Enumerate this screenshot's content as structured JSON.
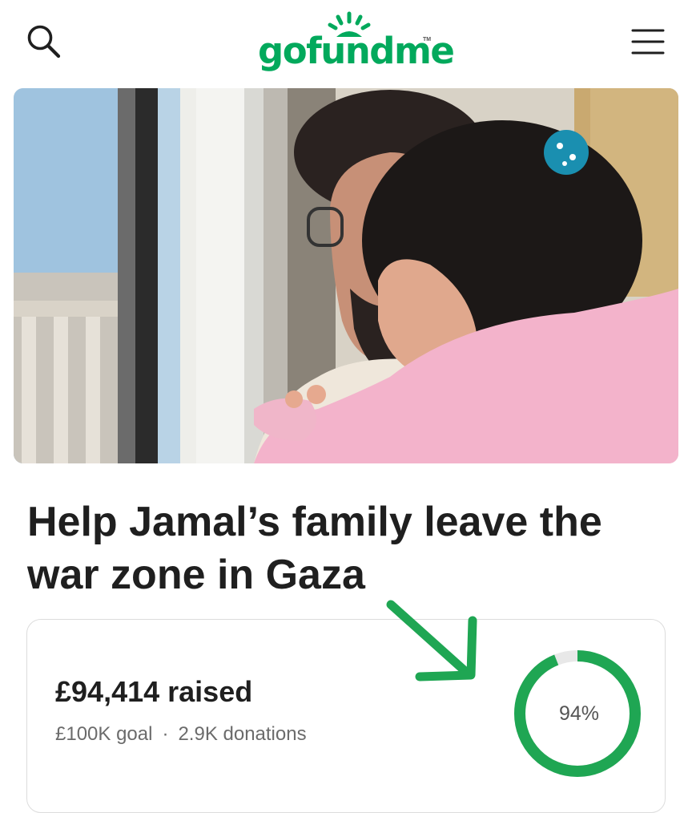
{
  "header": {
    "logo_text": "gofundme",
    "logo_tm": "TM"
  },
  "hero": {
    "image_icon": "fundraiser-photo"
  },
  "campaign": {
    "title": "Help Jamal’s family leave the war zone in Gaza"
  },
  "progress": {
    "raised_text": "£94,414 raised",
    "goal_text": "£100K goal",
    "separator": "·",
    "donations_text": "2.9K donations",
    "percent_text": "94%",
    "percent_value": 0.94
  },
  "colors": {
    "brand_green": "#02a95c",
    "ring_track": "#e8e8e8",
    "annotation_arrow": "#1fa653"
  },
  "icons": {
    "search": "search-icon",
    "menu": "hamburger-menu-icon",
    "annotation": "arrow-annotation-icon"
  }
}
